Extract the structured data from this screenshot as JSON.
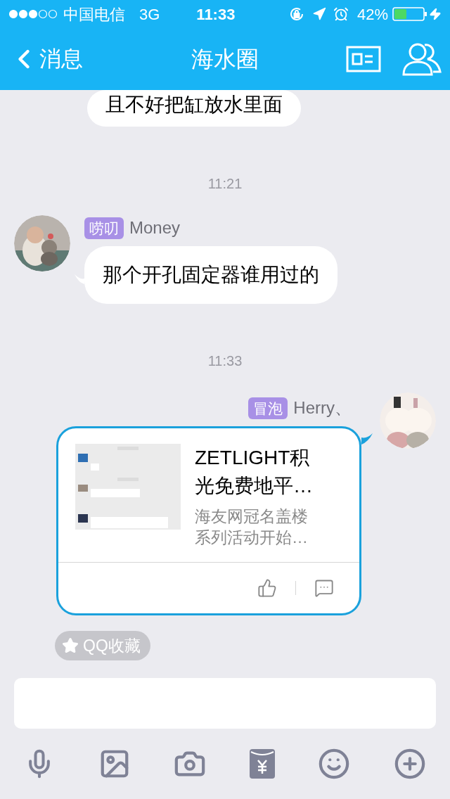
{
  "status_bar": {
    "carrier": "中国电信",
    "network": "3G",
    "time": "11:33",
    "battery": "42%"
  },
  "nav": {
    "back": "消息",
    "title": "海水圈"
  },
  "messages": [
    {
      "kind": "text",
      "outgoing": false,
      "text": "且不好把缸放水里面"
    },
    {
      "kind": "time",
      "text": "11:21"
    },
    {
      "kind": "text",
      "outgoing": false,
      "sender": {
        "badge": "唠叨",
        "name": "Money"
      },
      "text": "那个开孔固定器谁用过的"
    },
    {
      "kind": "time",
      "text": "11:33"
    },
    {
      "kind": "card",
      "outgoing": true,
      "sender": {
        "badge": "冒泡",
        "name": "Herry、"
      },
      "title": "ZETLIGHT积光免费地平…",
      "description": "海友网冠名盖楼系列活动开始…"
    }
  ],
  "favorite_chip": "QQ收藏"
}
